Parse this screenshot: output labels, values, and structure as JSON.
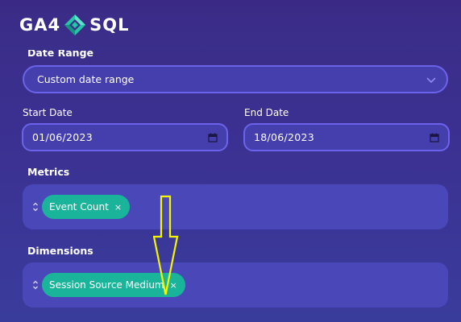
{
  "brand": {
    "left": "GA4",
    "right": "SQL",
    "logo_icon": "ga4-sql-diamond-logo"
  },
  "date_range": {
    "label": "Date Range",
    "selected": "Custom date range"
  },
  "start_date": {
    "label": "Start Date",
    "value": "01/06/2023"
  },
  "end_date": {
    "label": "End Date",
    "value": "18/06/2023"
  },
  "metrics": {
    "label": "Metrics",
    "chips": [
      "Event Count"
    ]
  },
  "dimensions": {
    "label": "Dimensions",
    "chips": [
      "Session Source Medium"
    ]
  },
  "chip_remove_glyph": "×",
  "annotation": {
    "arrow_color": "#f5f500"
  },
  "colors": {
    "background": "#3b3192",
    "input_fill": "#453fae",
    "input_border": "#6b63ea",
    "chip": "#19b49a",
    "logo_teal": "#22c7a8"
  }
}
